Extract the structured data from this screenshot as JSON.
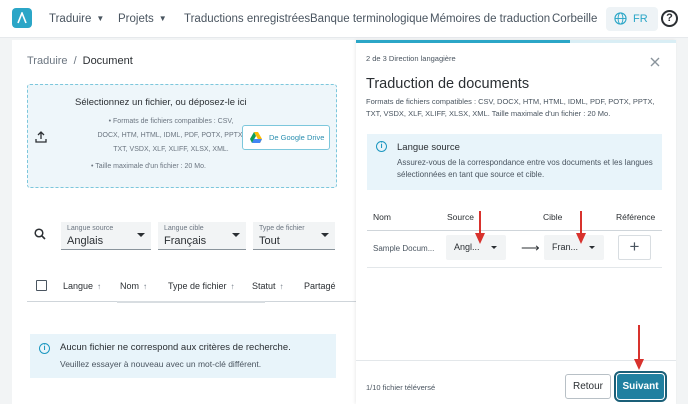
{
  "colors": {
    "accent": "#2ba6c7",
    "primary_button": "#2080a0",
    "annotation": "#d8322d",
    "info_bg": "#e8f4fa"
  },
  "nav": {
    "items": [
      {
        "label": "Traduire",
        "has_chevron": true
      },
      {
        "label": "Projets",
        "has_chevron": true
      },
      {
        "label": "Traductions enregistrées"
      },
      {
        "label": "Banque terminologique"
      },
      {
        "label": "Mémoires de traduction"
      },
      {
        "label": "Corbeille"
      }
    ],
    "language": "FR",
    "icons": {
      "logo": "app-logo-icon",
      "globe": "globe-icon",
      "help": "help-icon"
    }
  },
  "breadcrumb": {
    "parent": "Traduire",
    "separator": "/",
    "current": "Document"
  },
  "upload": {
    "title": "Sélectionnez un fichier, ou déposez-le ici",
    "formats_lines": [
      "Formats de fichiers compatibles : CSV,",
      "DOCX, HTM, HTML, IDML, PDF, POTX, PPTX,",
      "TXT, VSDX, XLF, XLIFF, XLSX, XML."
    ],
    "max_size": "Taille maximale d'un fichier : 20 Mo.",
    "gdrive_label": "De Google Drive"
  },
  "filters": [
    {
      "label": "Langue source",
      "value": "Anglais"
    },
    {
      "label": "Langue cible",
      "value": "Français"
    },
    {
      "label": "Type de fichier",
      "value": "Tout"
    }
  ],
  "table": {
    "columns": [
      {
        "label": "Langue",
        "sortable": true
      },
      {
        "label": "Nom",
        "sortable": true
      },
      {
        "label": "Type de fichier",
        "sortable": true
      },
      {
        "label": "Statut",
        "sortable": true
      },
      {
        "label": "Partagé",
        "sortable": false
      }
    ],
    "sort_icon": "↑"
  },
  "empty_state": {
    "title": "Aucun fichier ne correspond aux critères de recherche.",
    "text": "Veuillez essayer à nouveau avec un mot-clé différent."
  },
  "wizard": {
    "step": "2 de 3 Direction langagière",
    "progress": 0.67,
    "title": "Traduction de documents",
    "formats": "Formats de fichiers compatibles : CSV, DOCX, HTM, HTML, IDML, PDF, POTX, PPTX, TXT, VSDX, XLF, XLIFF, XLSX, XML. Taille maximale d'un fichier : 20 Mo.",
    "source_box": {
      "title": "Langue source",
      "text": "Assurez-vous de la correspondance entre vos documents et les langues sélectionnées en tant que source et cible."
    },
    "table": {
      "headers": {
        "name": "Nom",
        "source": "Source",
        "target": "Cible",
        "reference": "Référence"
      },
      "rows": [
        {
          "name": "Sample Docum...",
          "source": "Angl...",
          "target": "Fran..."
        }
      ],
      "arrow": "⟶",
      "add": "+"
    },
    "file_count": "1/10 fichier téléversé",
    "back_label": "Retour",
    "next_label": "Suivant"
  }
}
